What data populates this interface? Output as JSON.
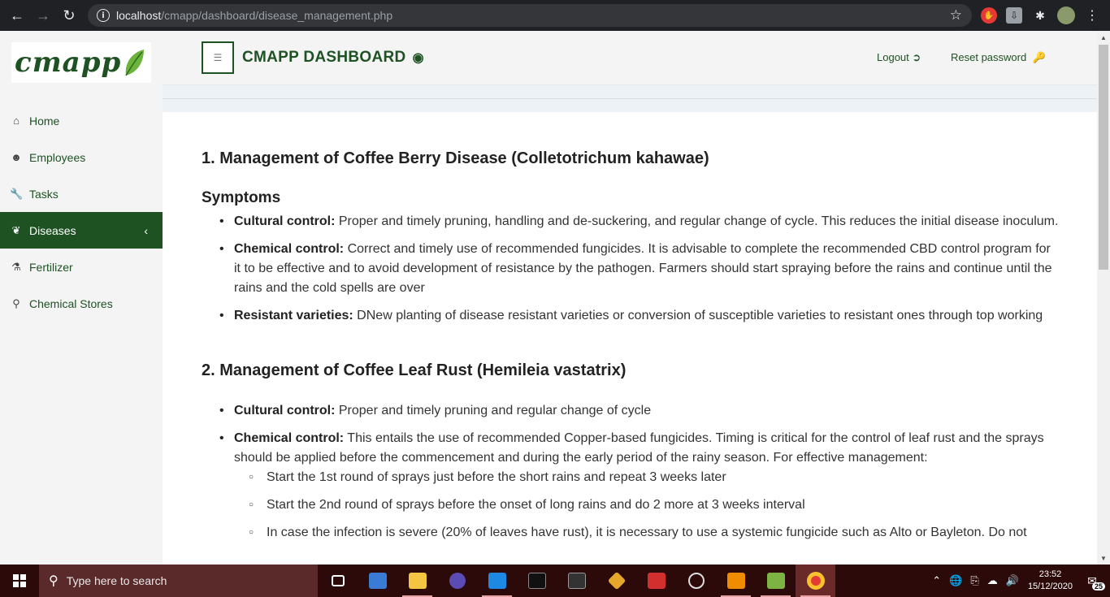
{
  "browser": {
    "url_host": "localhost",
    "url_path": "/cmapp/dashboard/disease_management.php"
  },
  "logo": {
    "text": "cmapp"
  },
  "sidebar": {
    "items": [
      {
        "label": "Home",
        "icon": "home-icon"
      },
      {
        "label": "Employees",
        "icon": "user-icon"
      },
      {
        "label": "Tasks",
        "icon": "wrench-icon"
      },
      {
        "label": "Diseases",
        "icon": "leaf-icon",
        "active": true
      },
      {
        "label": "Fertilizer",
        "icon": "flask-icon"
      },
      {
        "label": "Chemical Stores",
        "icon": "map-marker-icon"
      }
    ]
  },
  "header": {
    "title": "CMAPP DASHBOARD",
    "logout": "Logout",
    "reset_password": "Reset password"
  },
  "content": {
    "section1": {
      "title": "1. Management of Coffee Berry Disease (Colletotrichum kahawae)",
      "subtitle": "Symptoms",
      "items": [
        {
          "label": "Cultural control:",
          "text": " Proper and timely pruning, handling and de-suckering, and regular change of cycle. This reduces the initial disease inoculum."
        },
        {
          "label": "Chemical control:",
          "text": " Correct and timely use of recommended fungicides. It is advisable to complete the recommended CBD control program for it to be effective and to avoid development of resistance by the pathogen. Farmers should start spraying before the rains and continue until the rains and the cold spells are over"
        },
        {
          "label": "Resistant varieties:",
          "text": " DNew planting of disease resistant varieties or conversion of susceptible varieties to resistant ones through top working"
        }
      ]
    },
    "section2": {
      "title": "2. Management of Coffee Leaf Rust (Hemileia vastatrix)",
      "items": [
        {
          "label": "Cultural control:",
          "text": " Proper and timely pruning and regular change of cycle"
        },
        {
          "label": "Chemical control:",
          "text": " This entails the use of recommended Copper-based fungicides. Timing is critical for the control of leaf rust and the sprays should be applied before the commencement and during the early period of the rainy season. For effective management:"
        }
      ],
      "subitems": [
        "Start the 1st round of sprays just before the short rains and repeat 3 weeks later",
        "Start the 2nd round of sprays before the onset of long rains and do 2 more at 3 weeks interval",
        "In case the infection is severe (20% of leaves have rust), it is necessary to use a systemic fungicide such as Alto or Bayleton. Do not"
      ]
    }
  },
  "taskbar": {
    "search_placeholder": "Type here to search",
    "time": "23:52",
    "date": "15/12/2020",
    "notification_count": "25"
  }
}
